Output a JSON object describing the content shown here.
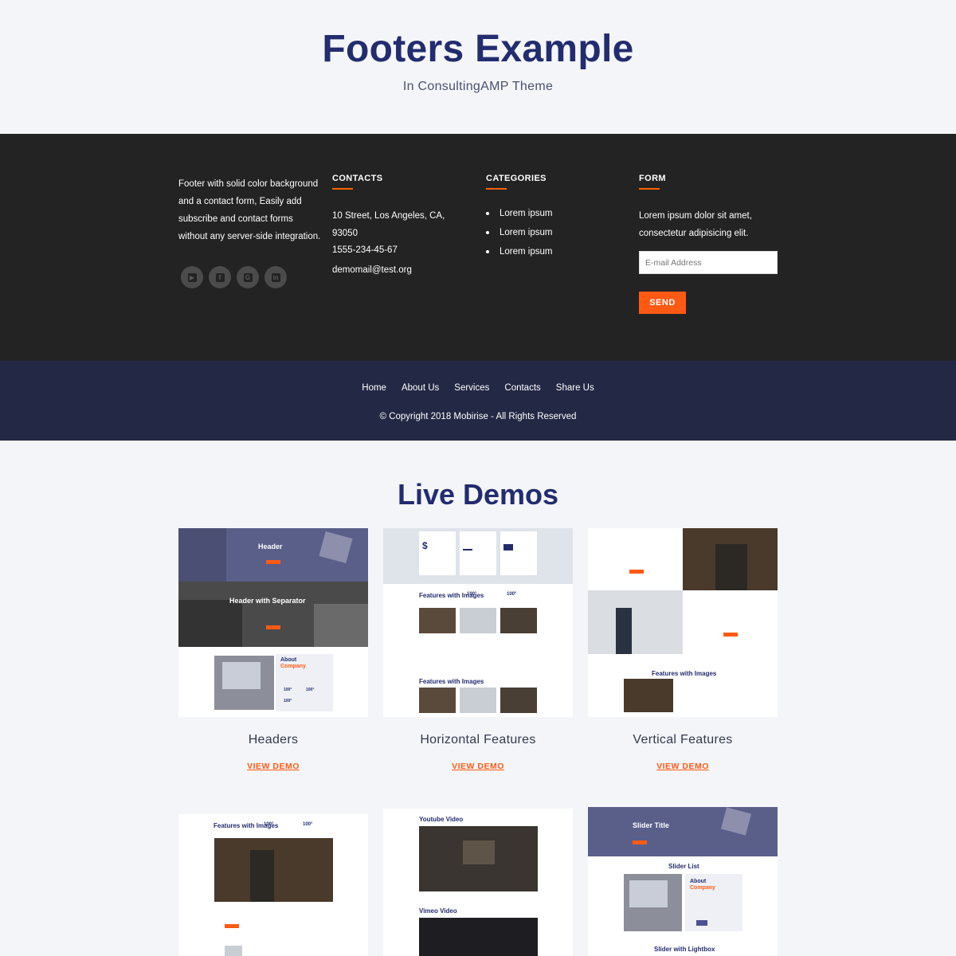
{
  "header": {
    "title": "Footers Example",
    "subtitle": "In ConsultingAMP Theme"
  },
  "footer": {
    "about_text": "Footer with solid color background and a contact form, Easily add subscribe and contact forms without any server-side integration.",
    "socials": [
      {
        "icon": "youtube-icon",
        "glyph": "▶"
      },
      {
        "icon": "facebook-icon",
        "glyph": "f"
      },
      {
        "icon": "google-plus-icon",
        "glyph": "G"
      },
      {
        "icon": "linkedin-icon",
        "glyph": "in"
      }
    ],
    "contacts": {
      "title": "CONTACTS",
      "address": "10 Street, Los Angeles, CA, 93050",
      "phone": "1555-234-45-67",
      "email": "demomail@test.org"
    },
    "categories": {
      "title": "CATEGORIES",
      "items": [
        "Lorem ipsum",
        "Lorem ipsum",
        "Lorem ipsum"
      ]
    },
    "form": {
      "title": "FORM",
      "text": "Lorem ipsum dolor sit amet, consectetur adipisicing elit.",
      "email_placeholder": "E-mail Address",
      "send_label": "SEND"
    },
    "accent_color": "#ff5a14"
  },
  "bottom_bar": {
    "links": [
      "Home",
      "About Us",
      "Services",
      "Contacts",
      "Share Us"
    ],
    "copyright": "© Copyright 2018 Mobirise - All Rights Reserved"
  },
  "live_demos": {
    "title": "Live Demos",
    "link_label": "VIEW DEMO",
    "cards": [
      {
        "name": "Headers"
      },
      {
        "name": "Horizontal Features"
      },
      {
        "name": "Vertical Features"
      }
    ],
    "thumbs": {
      "headers": {
        "t1": "Header",
        "t2": "Header with Separator",
        "t3": "About",
        "t4": "Company",
        "n1": "100°",
        "n2": "100°",
        "n3": "100°"
      },
      "horizontal": {
        "t1": "Features with Images",
        "n1": "100°",
        "n2": "100°",
        "t2": "Features with Images",
        "dollar": "$"
      },
      "vertical": {
        "t1": "Features with Images"
      },
      "row2a": {
        "t1": "Features with Images",
        "n1": "100°",
        "n2": "100°"
      },
      "row2b": {
        "t1": "Youtube Video",
        "t2": "Vimeo Video"
      },
      "row2c": {
        "t1": "Slider Title",
        "t2": "Slider List",
        "t3": "About",
        "t4": "Company",
        "t5": "Slider with Lightbox"
      }
    }
  }
}
